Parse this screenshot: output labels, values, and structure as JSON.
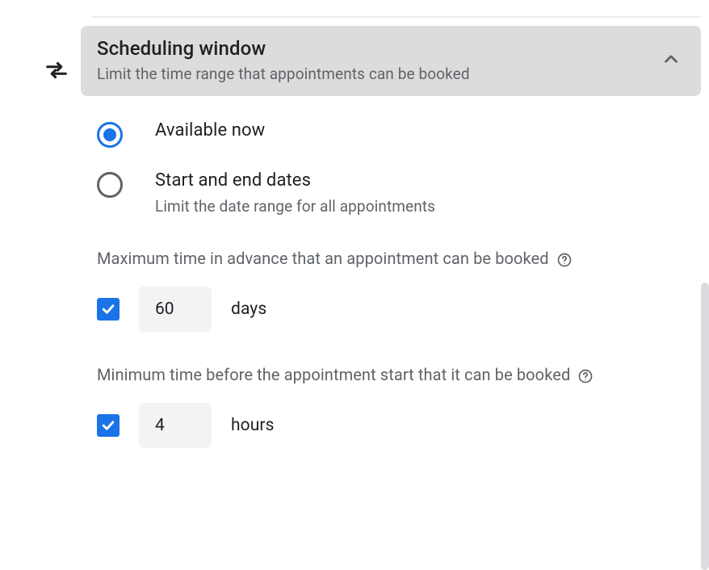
{
  "section": {
    "title": "Scheduling window",
    "subtitle": "Limit the time range that appointments can be booked"
  },
  "radios": {
    "available_now": {
      "label": "Available now"
    },
    "start_end": {
      "label": "Start and end dates",
      "sublabel": "Limit the date range for all appointments"
    }
  },
  "max_advance": {
    "label": "Maximum time in advance that an appointment can be booked",
    "value": "60",
    "unit": "days"
  },
  "min_before": {
    "label": "Minimum time before the appointment start that it can be booked",
    "value": "4",
    "unit": "hours"
  }
}
